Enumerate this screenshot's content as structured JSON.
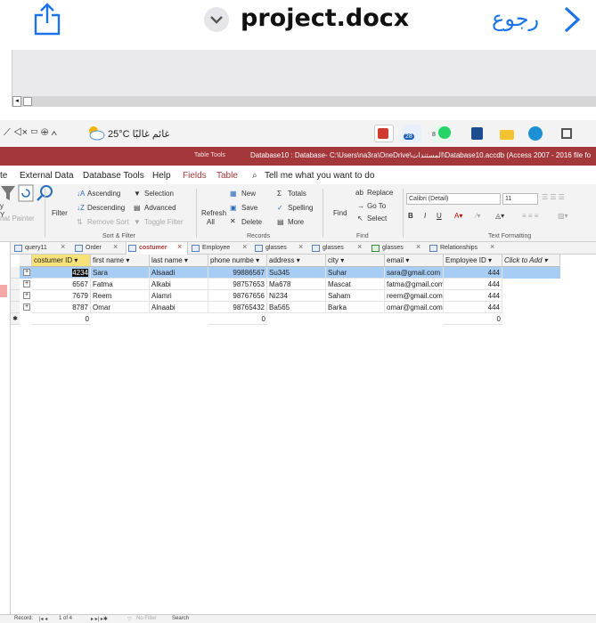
{
  "top_bar": {
    "title": "project.docx",
    "back_label": "رجوع"
  },
  "taskbar": {
    "tray_glyphs": "⟋ ◁× ▭ ⊕ ∧",
    "weather": "25°C  غائم غالبًا",
    "badge_count": "28",
    "chat_badge": "8"
  },
  "access": {
    "table_tools": "Table Tools",
    "db_title": "Database10 : Database- C:\\Users\\na3ra\\OneDrive\\المستندات\\Database10.accdb (Access 2007 - 2016 file fo",
    "menu": [
      "te",
      "External Data",
      "Database Tools",
      "Help",
      "Fields",
      "Table",
      "Tell me what you want to do"
    ],
    "ribbon": {
      "left_frag1": "y",
      "left_frag2": "Y",
      "format_painter": "nat Painter",
      "filter": "Filter",
      "ascending": "Ascending",
      "descending": "Descending",
      "remove_sort": "Remove Sort",
      "selection": "Selection",
      "advanced": "Advanced",
      "toggle_filter": "Toggle Filter",
      "sort_filter_group": "Sort & Filter",
      "refresh": "Refresh",
      "refresh_all": "All",
      "new": "New",
      "save": "Save",
      "delete": "Delete",
      "totals": "Totals",
      "spelling": "Spelling",
      "more": "More",
      "records_group": "Records",
      "find": "Find",
      "replace": "Replace",
      "goto": "Go To",
      "select": "Select",
      "find_group": "Find",
      "font_name": "Calibri (Detail)",
      "font_size": "11",
      "text_format_group": "Text Formatting"
    },
    "tabs": [
      "query11",
      "Order",
      "costumer",
      "Employee",
      "glasses",
      "glasses",
      "glasses",
      "Relationships"
    ],
    "columns": [
      "costumer ID",
      "first name",
      "last name",
      "phone numbe",
      "address",
      "city",
      "email",
      "Employee ID",
      "Click to Add"
    ],
    "rows": [
      {
        "id": "4234",
        "first": "Sara",
        "last": "Alsaadi",
        "phone": "99886567",
        "address": "Su345",
        "city": "Suhar",
        "email": "sara@gmail.com",
        "emp": "444"
      },
      {
        "id": "6567",
        "first": "Fatma",
        "last": "Alkabi",
        "phone": "98757653",
        "address": "Ma678",
        "city": "Mascat",
        "email": "fatma@gmail.com",
        "emp": "444"
      },
      {
        "id": "7679",
        "first": "Reem",
        "last": "Alamri",
        "phone": "98767656",
        "address": "Ni234",
        "city": "Saham",
        "email": "reem@gmail.com",
        "emp": "444"
      },
      {
        "id": "8787",
        "first": "Omar",
        "last": "Alnaabi",
        "phone": "98765432",
        "address": "Ba565",
        "city": "Barka",
        "email": "omar@gmail.com",
        "emp": "444"
      }
    ],
    "new_row": {
      "id": "0",
      "phone": "0",
      "emp": "0"
    },
    "status": {
      "record_label": "Record:",
      "record_pos": "1 of 4",
      "no_filter": "No Filter",
      "search": "Search"
    }
  },
  "colors": {
    "access_red": "#a4373a",
    "ios_blue": "#1a73e8",
    "selected_row": "#a8cdf5",
    "selected_header": "#f7e27a"
  }
}
